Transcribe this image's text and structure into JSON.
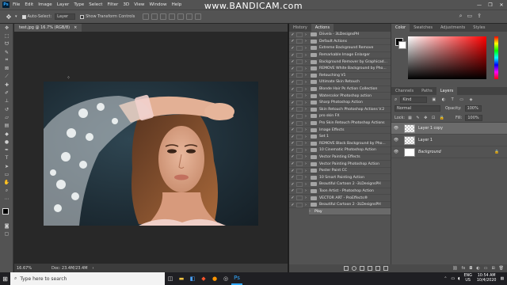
{
  "menubar": {
    "app_icon": "Ps",
    "items": [
      "File",
      "Edit",
      "Image",
      "Layer",
      "Type",
      "Select",
      "Filter",
      "3D",
      "View",
      "Window",
      "Help"
    ],
    "watermark_prefix": "www.",
    "watermark_brand": "BANDICAM",
    "watermark_suffix": ".com"
  },
  "options": {
    "auto_select_label": "Auto-Select:",
    "auto_select_value": "Layer",
    "transform_label": "Show Transform Controls"
  },
  "document": {
    "tab_title": "test.jpg @ 16.7% (RGB/8)",
    "tab_close": "×",
    "zoom": "16.67%",
    "doc_size": "Doc: 23.4M/23.4M"
  },
  "actions_panel": {
    "tabs": [
      "History",
      "Actions"
    ],
    "active_tab": "Actions",
    "items": [
      "Diivela - 3LDesignsPH",
      "Default Actions",
      "Extreme Background Remove",
      "Remarkable Image Enlarger",
      "Background Remover by Graphicad...",
      "REMOVE White Background by Pho...",
      "Retouching V1",
      "Ultimate Skin Retouch",
      "Blonde Hair Ps Action Collection",
      "Watercolor Photoshop action",
      "Sharp Photoshop Action",
      "Skin Retouch Photoshop Actions V.2",
      "pro skin FX",
      "Pro Skin Retouch Photoshop Actions",
      "Image Effects",
      "Set 1",
      "REMOVE Black Background by Pho...",
      "10 Cinematic Photoshop Action",
      "Vector Painting Effects",
      "Vector Painting Photoshop Action",
      "Poster Paint CC",
      "10 Smart Painting Action",
      "Beautiful Cartoon 2 -3LDesignsPH",
      "Toon Artist - Photoshop Action",
      "VECTOR ART - ProEffects®",
      "Beautiful Cartoon 2 -3LDesignsPH"
    ],
    "play_item": "Play"
  },
  "color_panel": {
    "tabs": [
      "Color",
      "Swatches",
      "Adjustments",
      "Styles"
    ],
    "active_tab": "Color"
  },
  "layers_panel": {
    "tabs": [
      "Channels",
      "Paths",
      "Layers"
    ],
    "active_tab": "Layers",
    "kind_label": "Kind",
    "blend_mode": "Normal",
    "opacity_label": "Opacity:",
    "opacity_value": "100%",
    "lock_label": "Lock:",
    "fill_label": "Fill:",
    "fill_value": "100%",
    "layers": [
      {
        "name": "Layer 1 copy",
        "selected": true
      },
      {
        "name": "Layer 1",
        "selected": false
      },
      {
        "name": "Background",
        "selected": false
      }
    ]
  },
  "taskbar": {
    "search_placeholder": "Type here to search",
    "language": "ENG",
    "region": "US",
    "time": "10:54 AM",
    "date": "10/4/2020"
  },
  "colors": {
    "ui_gray": "#535353",
    "canvas_bg": "#282828",
    "selection": "#6b6b6b",
    "taskbar": "#1f1f23"
  }
}
